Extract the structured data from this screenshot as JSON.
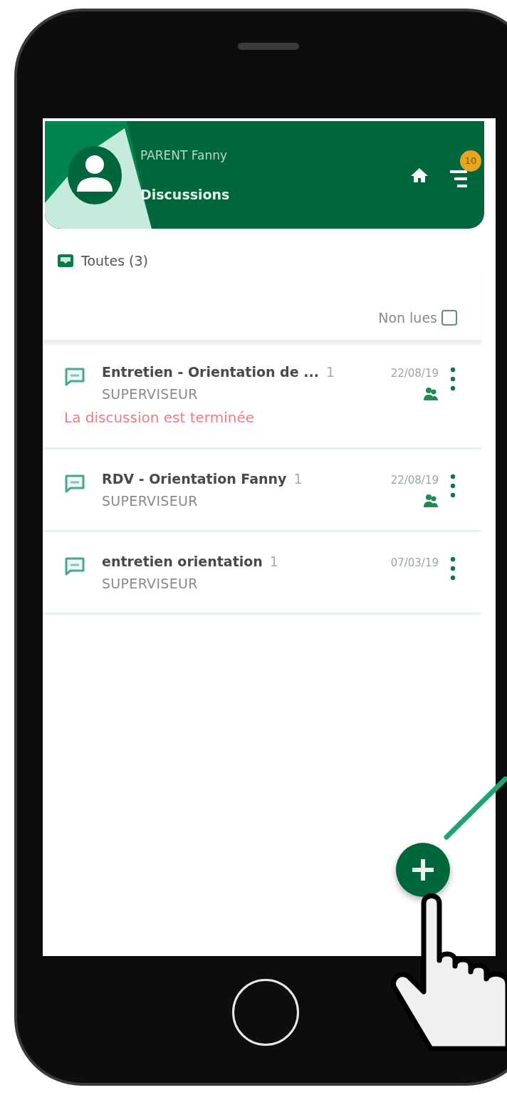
{
  "header": {
    "user_name": "PARENT Fanny",
    "title": "Discussions",
    "notification_count": "10"
  },
  "filter": {
    "label": "Toutes (3)"
  },
  "unread_filter": {
    "label": "Non lues",
    "checked": false
  },
  "discussions": [
    {
      "title": "Entretien - Orientation de ...",
      "count": "1",
      "author": "SUPERVISEUR",
      "date": "22/08/19",
      "shared": true,
      "status": "La discussion est terminée"
    },
    {
      "title": "RDV - Orientation Fanny",
      "count": "1",
      "author": "SUPERVISEUR",
      "date": "22/08/19",
      "shared": true
    },
    {
      "title": "entretien orientation",
      "count": "1",
      "author": "SUPERVISEUR",
      "date": "07/03/19",
      "shared": false
    }
  ]
}
